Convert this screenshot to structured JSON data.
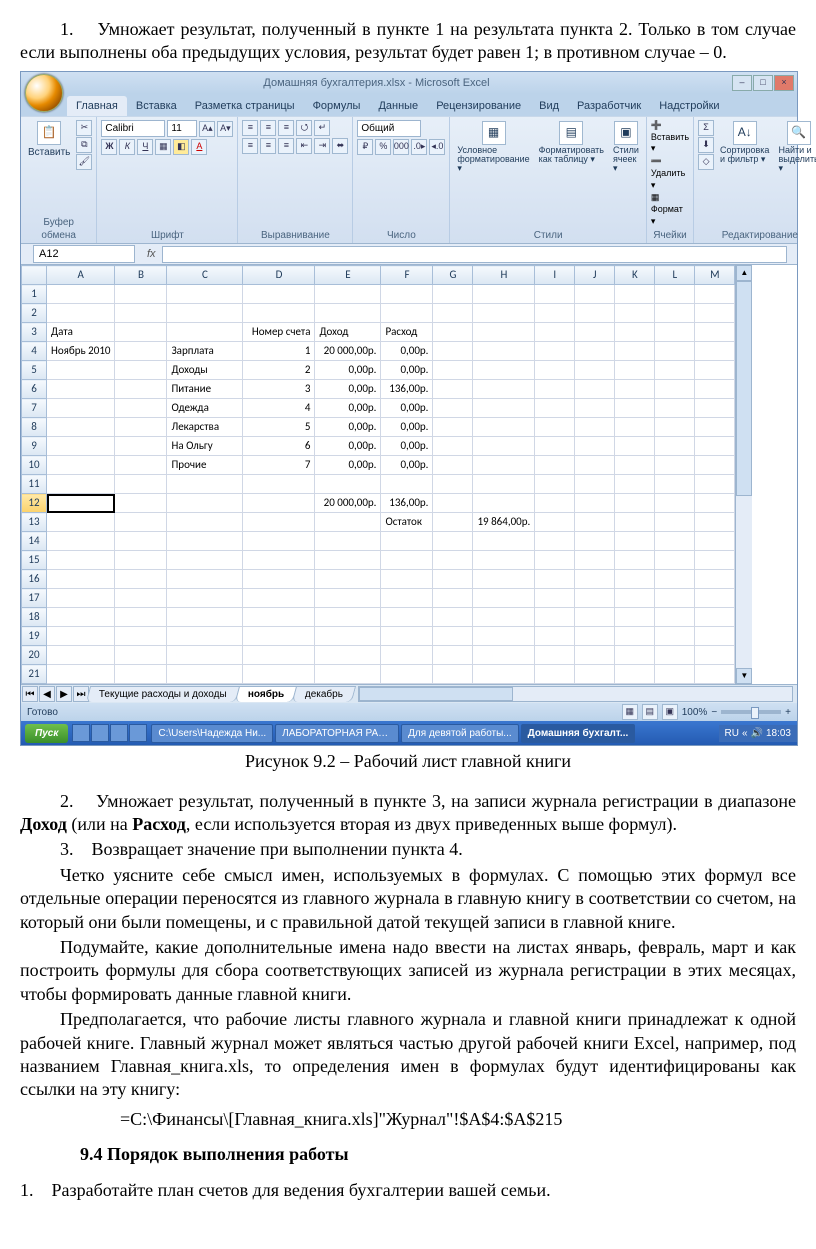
{
  "doc": {
    "p1a": "1.",
    "p1b": "Умножает результат, полученный в пункте 1 на результата пункта 2. Только в том случае если выполнены оба предыдущих условия, результат будет равен 1; в противном случае – 0.",
    "caption": "Рисунок 9.2 – Рабочий лист главной книги",
    "p2a": "2.",
    "p2b_1": "Умножает результат, полученный в пункте 3, на записи журнала регистрации в диапазоне ",
    "p2b_bold1": "Доход",
    "p2b_2": " (или на ",
    "p2b_bold2": "Расход",
    "p2b_3": ", если используется вторая из двух приведенных выше формул).",
    "p3a": "3.",
    "p3b": "Возвращает значение при выполнении пункта 4.",
    "p4": "Четко уясните себе смысл имен, используемых в формулах. С помощью этих формул все отдельные операции переносятся из главного журнала в главную книгу в соответствии со счетом, на который они были помещены, и с правильной датой текущей записи в главной книге.",
    "p5": "Подумайте, какие дополнительные имена надо ввести на листах январь, февраль, март и как построить формулы для сбора соответствующих записей из журнала регистрации в этих месяцах, чтобы формировать данные главной книги.",
    "p6": "Предполагается, что рабочие листы главного журнала и главной книги принадлежат к одной рабочей книге. Главный журнал может являться частью другой рабочей книги Excel, например, под названием Главная_книга.xls, то определения имен в формулах будут идентифицированы как ссылки на эту книгу:",
    "formula": "=C:\\Финансы\\[Главная_книга.xls]\"Журнал\"!$A$4:$A$215",
    "heading": "9.4 Порядок выполнения работы",
    "p7a": "1.",
    "p7b": "Разработайте план счетов для ведения бухгалтерии вашей семьи."
  },
  "excel": {
    "title": "Домашняя бухгалтерия.xlsx - Microsoft Excel",
    "tabs": [
      "Главная",
      "Вставка",
      "Разметка страницы",
      "Формулы",
      "Данные",
      "Рецензирование",
      "Вид",
      "Разработчик",
      "Надстройки"
    ],
    "groups": {
      "clipboard": "Буфер обмена",
      "clipboard_btn": "Вставить",
      "font": "Шрифт",
      "font_name": "Calibri",
      "font_size": "11",
      "align": "Выравнивание",
      "number": "Число",
      "number_format": "Общий",
      "styles": "Стили",
      "styles_cond": "Условное форматирование ▾",
      "styles_table": "Форматировать как таблицу ▾",
      "styles_cell": "Стили ячеек ▾",
      "cells": "Ячейки",
      "cells_insert": "Вставить ▾",
      "cells_delete": "Удалить ▾",
      "cells_format": "Формат ▾",
      "editing": "Редактирование",
      "editing_sort": "Сортировка и фильтр ▾",
      "editing_find": "Найти и выделить ▾"
    },
    "name_box": "A12",
    "cols": [
      "",
      "A",
      "B",
      "C",
      "D",
      "E",
      "F",
      "G",
      "H",
      "I",
      "J",
      "K",
      "L",
      "M"
    ],
    "rows": [
      {
        "n": "1",
        "cells": [
          "",
          "",
          "",
          "",
          "",
          "",
          "",
          "",
          "",
          "",
          "",
          "",
          ""
        ]
      },
      {
        "n": "2",
        "cells": [
          "",
          "",
          "",
          "",
          "",
          "",
          "",
          "",
          "",
          "",
          "",
          "",
          ""
        ]
      },
      {
        "n": "3",
        "cells": [
          "Дата",
          "",
          "",
          "Номер счета",
          "Доход",
          "Расход",
          "",
          "",
          "",
          "",
          "",
          "",
          ""
        ]
      },
      {
        "n": "4",
        "cells": [
          "Ноябрь 2010",
          "",
          "Зарплата",
          "1",
          "20 000,00р.",
          "0,00р.",
          "",
          "",
          "",
          "",
          "",
          "",
          ""
        ]
      },
      {
        "n": "5",
        "cells": [
          "",
          "",
          "Доходы",
          "2",
          "0,00р.",
          "0,00р.",
          "",
          "",
          "",
          "",
          "",
          "",
          ""
        ]
      },
      {
        "n": "6",
        "cells": [
          "",
          "",
          "Питание",
          "3",
          "0,00р.",
          "136,00р.",
          "",
          "",
          "",
          "",
          "",
          "",
          ""
        ]
      },
      {
        "n": "7",
        "cells": [
          "",
          "",
          "Одежда",
          "4",
          "0,00р.",
          "0,00р.",
          "",
          "",
          "",
          "",
          "",
          "",
          ""
        ]
      },
      {
        "n": "8",
        "cells": [
          "",
          "",
          "Лекарства",
          "5",
          "0,00р.",
          "0,00р.",
          "",
          "",
          "",
          "",
          "",
          "",
          ""
        ]
      },
      {
        "n": "9",
        "cells": [
          "",
          "",
          "На Ольгу",
          "6",
          "0,00р.",
          "0,00р.",
          "",
          "",
          "",
          "",
          "",
          "",
          ""
        ]
      },
      {
        "n": "10",
        "cells": [
          "",
          "",
          "Прочие",
          "7",
          "0,00р.",
          "0,00р.",
          "",
          "",
          "",
          "",
          "",
          "",
          ""
        ]
      },
      {
        "n": "11",
        "cells": [
          "",
          "",
          "",
          "",
          "",
          "",
          "",
          "",
          "",
          "",
          "",
          "",
          ""
        ]
      },
      {
        "n": "12",
        "cells": [
          "",
          "",
          "",
          "",
          "20 000,00р.",
          "136,00р.",
          "",
          "",
          "",
          "",
          "",
          "",
          ""
        ]
      },
      {
        "n": "13",
        "cells": [
          "",
          "",
          "",
          "",
          "",
          "Остаток",
          "",
          "19 864,00р.",
          "",
          "",
          "",
          "",
          ""
        ]
      },
      {
        "n": "14",
        "cells": [
          "",
          "",
          "",
          "",
          "",
          "",
          "",
          "",
          "",
          "",
          "",
          "",
          ""
        ]
      },
      {
        "n": "15",
        "cells": [
          "",
          "",
          "",
          "",
          "",
          "",
          "",
          "",
          "",
          "",
          "",
          "",
          ""
        ]
      },
      {
        "n": "16",
        "cells": [
          "",
          "",
          "",
          "",
          "",
          "",
          "",
          "",
          "",
          "",
          "",
          "",
          ""
        ]
      },
      {
        "n": "17",
        "cells": [
          "",
          "",
          "",
          "",
          "",
          "",
          "",
          "",
          "",
          "",
          "",
          "",
          ""
        ]
      },
      {
        "n": "18",
        "cells": [
          "",
          "",
          "",
          "",
          "",
          "",
          "",
          "",
          "",
          "",
          "",
          "",
          ""
        ]
      },
      {
        "n": "19",
        "cells": [
          "",
          "",
          "",
          "",
          "",
          "",
          "",
          "",
          "",
          "",
          "",
          "",
          ""
        ]
      },
      {
        "n": "20",
        "cells": [
          "",
          "",
          "",
          "",
          "",
          "",
          "",
          "",
          "",
          "",
          "",
          "",
          ""
        ]
      },
      {
        "n": "21",
        "cells": [
          "",
          "",
          "",
          "",
          "",
          "",
          "",
          "",
          "",
          "",
          "",
          "",
          ""
        ]
      }
    ],
    "sheet_tabs": [
      "Текущие расходы и доходы",
      "ноябрь",
      "декабрь"
    ],
    "active_sheet": 1,
    "status_ready": "Готово",
    "zoom": "100%"
  },
  "taskbar": {
    "start": "Пуск",
    "tasks": [
      "C:\\Users\\Надежда Ни...",
      "ЛАБОРАТОРНАЯ РАБ...",
      "Для девятой работы...",
      "Домашняя бухгалт..."
    ],
    "active": 3,
    "lang": "RU",
    "time": "18:03"
  }
}
